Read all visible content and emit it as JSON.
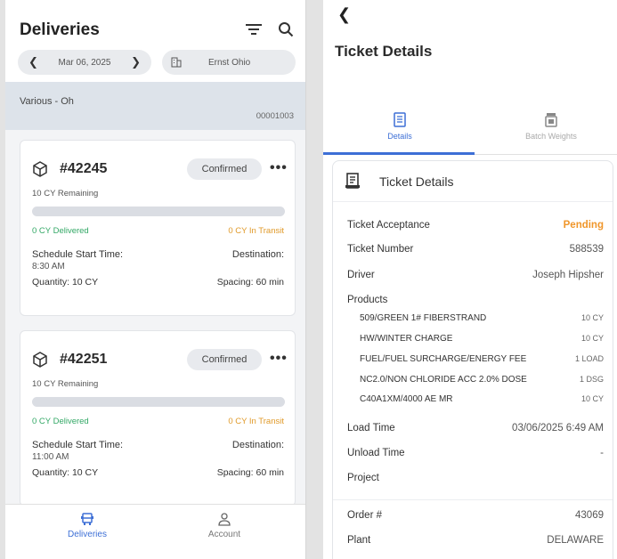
{
  "deliveries": {
    "title": "Deliveries",
    "date": "Mar 06, 2025",
    "plant": "Ernst Ohio",
    "location_group": {
      "name": "Various - Oh",
      "code": "00001003"
    },
    "tickets": [
      {
        "number": "#42245",
        "status": "Confirmed",
        "remaining": "10 CY Remaining",
        "delivered_fraction": 0,
        "delivered": "0 CY Delivered",
        "in_transit": "0 CY In Transit",
        "schedule_label": "Schedule Start Time:",
        "schedule_time": "8:30 AM",
        "destination_label": "Destination:",
        "quantity": "Quantity: 10 CY",
        "spacing": "Spacing: 60 min"
      },
      {
        "number": "#42251",
        "status": "Confirmed",
        "remaining": "10 CY Remaining",
        "delivered_fraction": 0,
        "delivered": "0 CY Delivered",
        "in_transit": "0 CY In Transit",
        "schedule_label": "Schedule Start Time:",
        "schedule_time": "11:00 AM",
        "destination_label": "Destination:",
        "quantity": "Quantity: 10 CY",
        "spacing": "Spacing: 60 min"
      }
    ],
    "nav": [
      {
        "label": "Deliveries",
        "active": true
      },
      {
        "label": "Account",
        "active": false
      }
    ]
  },
  "ticket": {
    "page_title": "Ticket Details",
    "tabs": [
      {
        "label": "Details",
        "active": true
      },
      {
        "label": "Batch Weights",
        "active": false
      }
    ],
    "card_title": "Ticket Details",
    "acceptance_label": "Ticket Acceptance",
    "acceptance_value": "Pending",
    "number_label": "Ticket Number",
    "number_value": "588539",
    "driver_label": "Driver",
    "driver_value": "Joseph Hipsher",
    "products_label": "Products",
    "products": [
      {
        "name": "509/GREEN 1# FIBERSTRAND",
        "qty": "10 CY"
      },
      {
        "name": "HW/WINTER CHARGE",
        "qty": "10 CY"
      },
      {
        "name": "FUEL/FUEL SURCHARGE/ENERGY FEE",
        "qty": "1 LOAD"
      },
      {
        "name": "NC2.0/NON CHLORIDE ACC 2.0% DOSE",
        "qty": "1 DSG"
      },
      {
        "name": "C40A1XM/4000 AE MR",
        "qty": "10 CY"
      }
    ],
    "load_time_label": "Load Time",
    "load_time_value": "03/06/2025 6:49 AM",
    "unload_time_label": "Unload Time",
    "unload_time_value": "-",
    "project_label": "Project",
    "order_label": "Order #",
    "order_value": "43069",
    "plant_label": "Plant",
    "plant_value": "DELAWARE"
  },
  "colors": {
    "accent": "#3d6fd6",
    "pending": "#f0962a",
    "delivered": "#33a866",
    "in_transit": "#e09a2a"
  }
}
